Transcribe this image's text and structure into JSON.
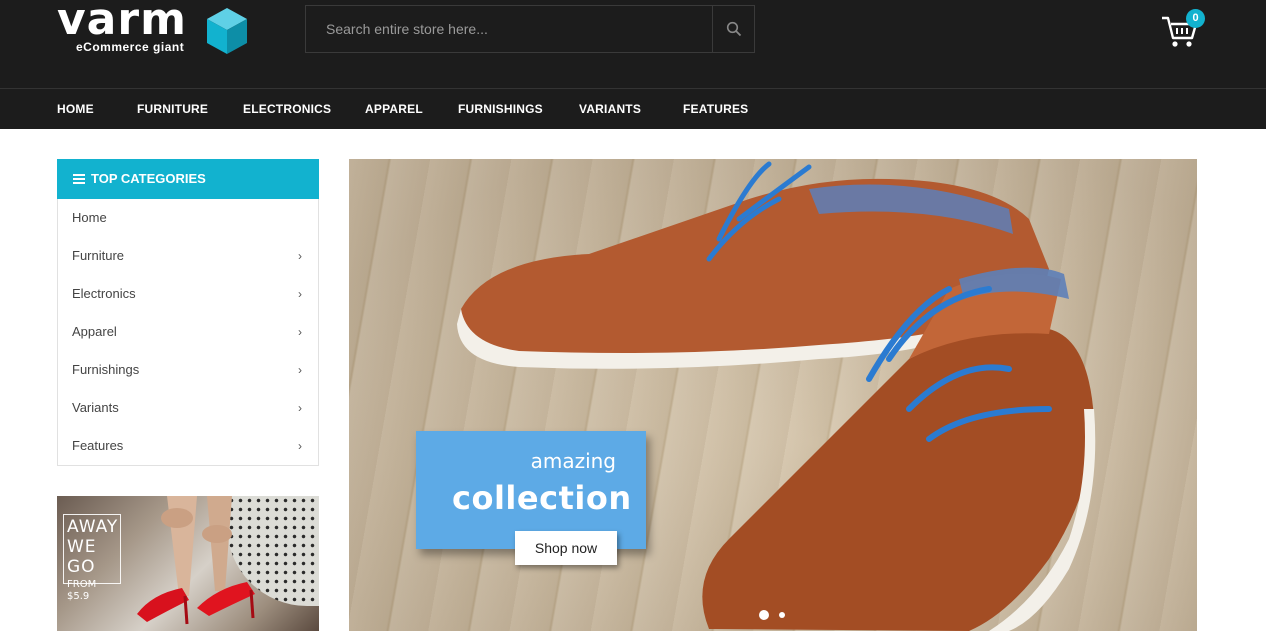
{
  "header": {
    "logo_text": "varm",
    "logo_tagline": "eCommerce giant",
    "search_placeholder": "Search entire store here...",
    "cart_count": "0"
  },
  "nav": {
    "items": [
      "HOME",
      "FURNITURE",
      "ELECTRONICS",
      "APPAREL",
      "FURNISHINGS",
      "VARIANTS",
      "FEATURES"
    ]
  },
  "sidebar": {
    "title": "TOP CATEGORIES",
    "items": [
      {
        "label": "Home",
        "has_submenu": false
      },
      {
        "label": "Furniture",
        "has_submenu": true
      },
      {
        "label": "Electronics",
        "has_submenu": true
      },
      {
        "label": "Apparel",
        "has_submenu": true
      },
      {
        "label": "Furnishings",
        "has_submenu": true
      },
      {
        "label": "Variants",
        "has_submenu": true
      },
      {
        "label": "Features",
        "has_submenu": true
      }
    ],
    "promo": {
      "line1": "AWAY",
      "line2": "WE GO",
      "line3": "FROM $5.9"
    }
  },
  "hero": {
    "subtitle": "amazing",
    "title": "collection",
    "button_label": "Shop now",
    "slides_total": 2,
    "active_slide": 1
  },
  "colors": {
    "accent": "#12b2cf",
    "header_bg": "#1c1c1c",
    "banner_box": "#5daae6",
    "laces": "#2b7bd1"
  },
  "icons": {
    "search": "search-icon",
    "cart": "cart-icon",
    "menu": "menu-icon",
    "chevron": "chevron-right-icon"
  }
}
